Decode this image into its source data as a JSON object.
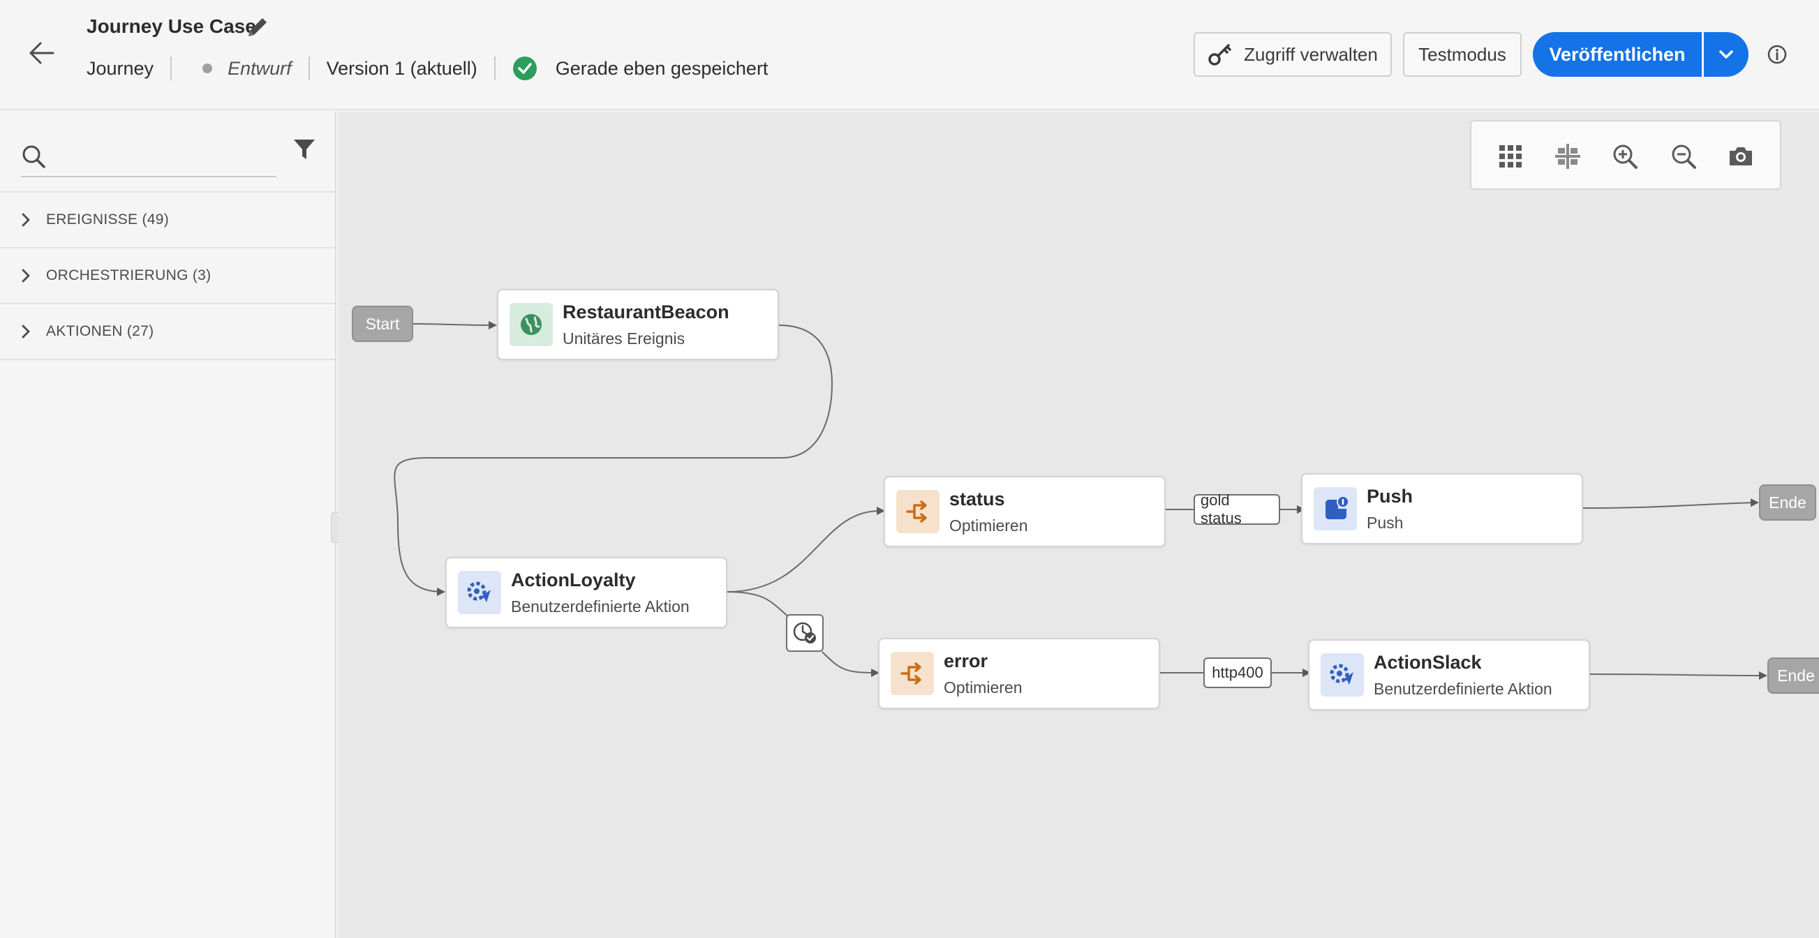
{
  "header": {
    "title": "Journey Use Case",
    "type_label": "Journey",
    "status": "Entwurf",
    "version": "Version 1 (aktuell)",
    "saved_text": "Gerade eben gespeichert",
    "manage_access_label": "Zugriff verwalten",
    "test_mode_label": "Testmodus",
    "publish_label": "Veröffentlichen"
  },
  "sidebar": {
    "search": {
      "placeholder": "",
      "value": ""
    },
    "sections": [
      {
        "label": "EREIGNISSE (49)"
      },
      {
        "label": "ORCHESTRIERUNG (3)"
      },
      {
        "label": "AKTIONEN (27)"
      }
    ]
  },
  "canvas": {
    "start_label": "Start",
    "end_label": "Ende",
    "nodes": {
      "restaurant_beacon": {
        "title": "RestaurantBeacon",
        "subtitle": "Unitäres Ereignis",
        "icon": "globe-icon"
      },
      "action_loyalty": {
        "title": "ActionLoyalty",
        "subtitle": "Benutzerdefinierte Aktion",
        "icon": "custom-action-icon"
      },
      "status": {
        "title": "status",
        "subtitle": "Optimieren",
        "icon": "condition-split-icon"
      },
      "error": {
        "title": "error",
        "subtitle": "Optimieren",
        "icon": "condition-split-icon"
      },
      "push": {
        "title": "Push",
        "subtitle": "Push",
        "icon": "push-notification-icon"
      },
      "action_slack": {
        "title": "ActionSlack",
        "subtitle": "Benutzerdefinierte Aktion",
        "icon": "custom-action-icon"
      }
    },
    "edge_labels": {
      "gold_status": "gold status",
      "http400": "http400"
    }
  },
  "colors": {
    "accent": "#1473e6",
    "success": "#2d9d5c",
    "event_icon_bg": "#d7ecdf",
    "action_icon_bg": "#dde6f7",
    "condition_icon_bg": "#f6e2cc"
  }
}
